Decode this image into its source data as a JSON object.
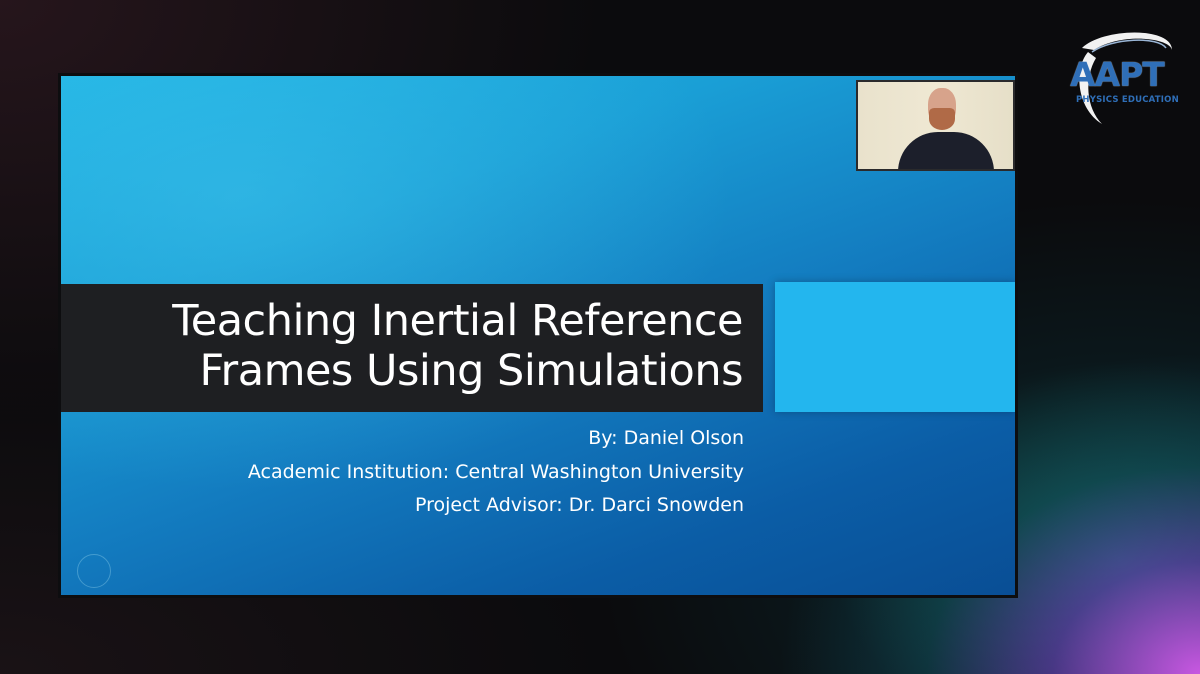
{
  "logo": {
    "text": "AAPT",
    "tagline": "PHYSICS EDUCATION",
    "color": "#2f6fb8"
  },
  "slide": {
    "title_lines": [
      "Teaching Inertial Reference",
      "Frames Using Simulations"
    ],
    "byline": [
      "By: Daniel Olson",
      "Academic Institution: Central Washington University",
      "Project Advisor: Dr. Darci Snowden"
    ],
    "colors": {
      "background_light": "#20b3e3",
      "background_dark": "#094e95",
      "title_bar": "#1e1f22",
      "accent_box": "#23b6ee",
      "text": "#ffffff"
    }
  },
  "webcam": {
    "icon": "presenter-video-feed"
  }
}
